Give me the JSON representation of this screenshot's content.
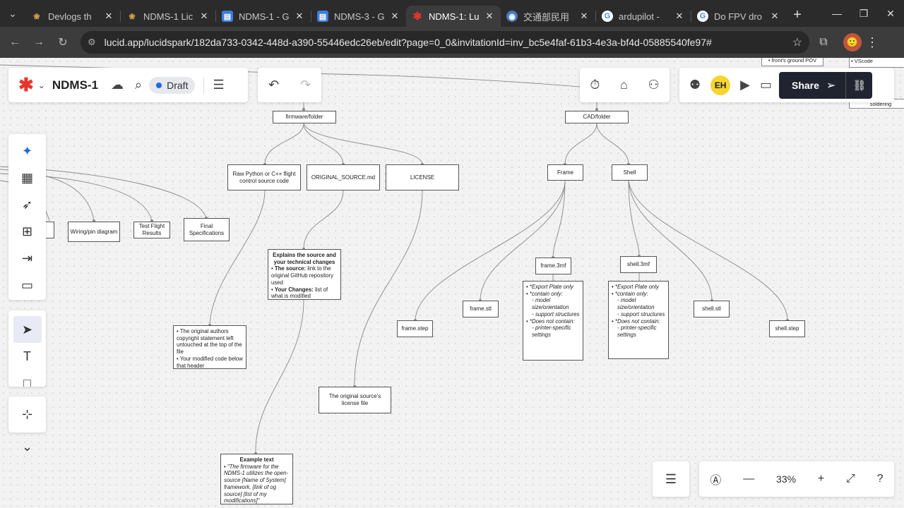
{
  "browser": {
    "tabs": [
      {
        "title": "Devlogs th",
        "color": "#6b5a2c",
        "glyph": "❀"
      },
      {
        "title": "NDMS-1 Lic",
        "color": "#6b5a2c",
        "glyph": "❀"
      },
      {
        "title": "NDMS-1 - G",
        "color": "#3b7ddd",
        "glyph": "▤"
      },
      {
        "title": "NDMS-3 - G",
        "color": "#3b7ddd",
        "glyph": "▤"
      },
      {
        "title": "NDMS-1: Lu",
        "color": "#e8352b",
        "glyph": "✱"
      },
      {
        "title": "交通部民用",
        "color": "#4a78c9",
        "glyph": "◉"
      },
      {
        "title": "ardupilot -",
        "color": "#ffffff",
        "glyph": "G"
      },
      {
        "title": "Do FPV dro",
        "color": "#ffffff",
        "glyph": "G"
      }
    ],
    "url": "lucid.app/lucidspark/182da733-0342-448d-a390-55446edc26eb/edit?page=0_0&invitationId=inv_bc5e4faf-61b3-4e3a-bf4d-05885540fe97#"
  },
  "header": {
    "doc_title": "NDMS-1",
    "status": "Draft",
    "user_initials": "EH",
    "share_label": "Share"
  },
  "zoom": {
    "level": "33%"
  },
  "diagram": {
    "firmware_folder": "firmware/folder",
    "cad_folder": "CAD/folder",
    "raw_code": "Raw Python or C++ flight control source code",
    "original_source": "ORIGINAL_SOURCE.md",
    "license": "LICENSE",
    "frame": "Frame",
    "shell": "Shell",
    "wiring": "Wiring/pin diagram",
    "test_flight": "Test Flight Results",
    "final_specs": "Final Specifications",
    "frame_3mf": "frame.3mf",
    "shell_3mf": "shell.3mf",
    "frame_stl": "frame.stl",
    "frame_step": "frame.step",
    "shell_stl": "shell.stl",
    "shell_step": "shell.step",
    "license_note": "The original source's license file",
    "explain_head": "Explains the source and your technical changes",
    "explain_source_b": "The source:",
    "explain_source": " link to the original GitHub repository used",
    "explain_changes_b": "Your Changes:",
    "explain_changes": " list of what is modified",
    "authors_1": "The original authors copyright statement left untouched at the top of the file",
    "authors_2": "Your modified code below that header",
    "export_1": "*Export Plate only",
    "export_2": "*contain only:",
    "export_3": "model size/orientation",
    "export_4": "support structures",
    "export_5": "*Does not contain:",
    "export_6": "printer-specific settings",
    "example_head": "Example text",
    "example_body": "\"The firmware for the NDMS-1 utilizes the open-source [Name of System] framework. [link of og source] [list of my modifications]\"",
    "topright_1": "• front's ground POV",
    "topright_2": "• VScode",
    "topright_3": "soldering"
  }
}
